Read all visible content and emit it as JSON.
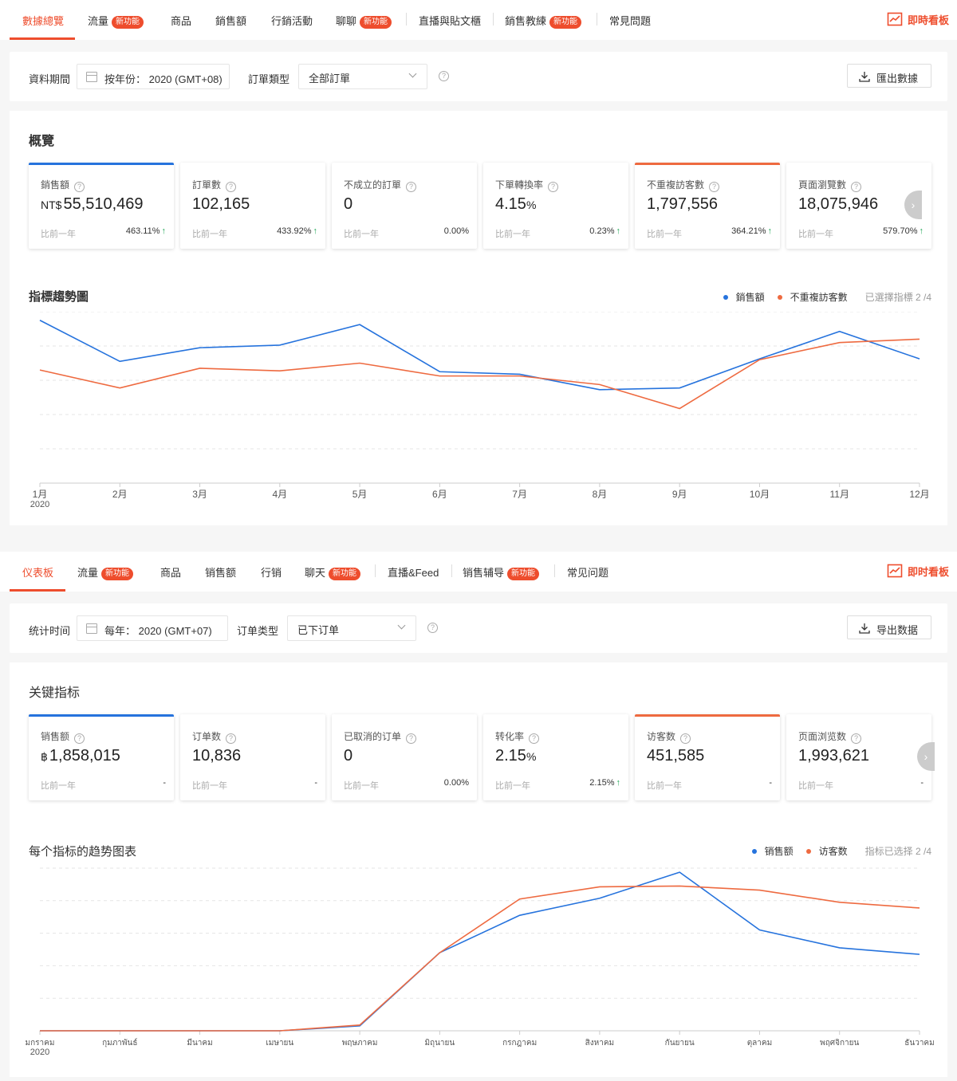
{
  "panel1": {
    "tabs": [
      {
        "label": "數據總覽",
        "badge": "",
        "active": true
      },
      {
        "label": "流量",
        "badge": "新功能"
      },
      {
        "label": "商品",
        "badge": ""
      },
      {
        "label": "銷售額",
        "badge": ""
      },
      {
        "label": "行銷活動",
        "badge": ""
      },
      {
        "label": "聊聊",
        "badge": "新功能"
      },
      {
        "label": "直播與貼文櫃",
        "badge": ""
      },
      {
        "label": "銷售教練",
        "badge": "新功能"
      },
      {
        "label": "常見問題",
        "badge": ""
      }
    ],
    "live_label": "即時看板",
    "filter": {
      "period_label": "資料期間",
      "period_value": "按年份： 2020 (GMT+08)",
      "order_type_label": "訂單類型",
      "order_type_value": "全部訂單",
      "export_label": "匯出數據"
    },
    "overview_title": "概覽",
    "cards": [
      {
        "label": "銷售額",
        "currency": "NT$",
        "value": "55,510,469",
        "pct": "",
        "prev": "比前一年",
        "change": "463.11%",
        "up": true,
        "accent": "blue"
      },
      {
        "label": "訂單數",
        "currency": "",
        "value": "102,165",
        "pct": "",
        "prev": "比前一年",
        "change": "433.92%",
        "up": true,
        "accent": ""
      },
      {
        "label": "不成立的訂單",
        "currency": "",
        "value": "0",
        "pct": "",
        "prev": "比前一年",
        "change": "0.00%",
        "up": false,
        "accent": ""
      },
      {
        "label": "下單轉換率",
        "currency": "",
        "value": "4.15",
        "pct": "%",
        "prev": "比前一年",
        "change": "0.23%",
        "up": true,
        "accent": ""
      },
      {
        "label": "不重複訪客數",
        "currency": "",
        "value": "1,797,556",
        "pct": "",
        "prev": "比前一年",
        "change": "364.21%",
        "up": true,
        "accent": "orange"
      },
      {
        "label": "頁面瀏覽數",
        "currency": "",
        "value": "18,075,946",
        "pct": "",
        "prev": "比前一年",
        "change": "579.70%",
        "up": true,
        "accent": ""
      }
    ],
    "trend_title": "指標趨勢圖",
    "legend": {
      "s1": "銷售額",
      "s2": "不重複訪客數",
      "selected": "已選擇指標 2 /4"
    }
  },
  "panel2": {
    "tabs": [
      {
        "label": "仪表板",
        "badge": "",
        "active": true
      },
      {
        "label": "流量",
        "badge": "新功能"
      },
      {
        "label": "商品",
        "badge": ""
      },
      {
        "label": "销售额",
        "badge": ""
      },
      {
        "label": "行销",
        "badge": ""
      },
      {
        "label": "聊天",
        "badge": "新功能"
      },
      {
        "label": "直播&Feed",
        "badge": ""
      },
      {
        "label": "销售辅导",
        "badge": "新功能"
      },
      {
        "label": "常见问题",
        "badge": ""
      }
    ],
    "live_label": "即时看板",
    "filter": {
      "period_label": "统计时间",
      "period_value": "每年： 2020 (GMT+07)",
      "order_type_label": "订单类型",
      "order_type_value": "已下订单",
      "export_label": "导出数据"
    },
    "overview_title": "关键指标",
    "cards": [
      {
        "label": "销售额",
        "currency": "฿",
        "value": "1,858,015",
        "pct": "",
        "prev": "比前一年",
        "change": "-",
        "up": false,
        "accent": "blue"
      },
      {
        "label": "订单数",
        "currency": "",
        "value": "10,836",
        "pct": "",
        "prev": "比前一年",
        "change": "-",
        "up": false,
        "accent": ""
      },
      {
        "label": "已取消的订单",
        "currency": "",
        "value": "0",
        "pct": "",
        "prev": "比前一年",
        "change": "0.00%",
        "up": false,
        "accent": ""
      },
      {
        "label": "转化率",
        "currency": "",
        "value": "2.15",
        "pct": "%",
        "prev": "比前一年",
        "change": "2.15%",
        "up": true,
        "accent": ""
      },
      {
        "label": "访客数",
        "currency": "",
        "value": "451,585",
        "pct": "",
        "prev": "比前一年",
        "change": "-",
        "up": false,
        "accent": "orange"
      },
      {
        "label": "页面浏览数",
        "currency": "",
        "value": "1,993,621",
        "pct": "",
        "prev": "比前一年",
        "change": "-",
        "up": false,
        "accent": ""
      }
    ],
    "trend_title": "每个指标的趋势图表",
    "legend": {
      "s1": "销售额",
      "s2": "访客数",
      "selected": "指标已选择 2 /4"
    }
  },
  "colors": {
    "accent": "#ee4d2d",
    "blue_series": "#2673dd",
    "orange_series": "#ee6a40",
    "up": "#26aa5a"
  },
  "chart_data": [
    {
      "type": "line",
      "title": "指標趨勢圖",
      "x": [
        "1月",
        "2月",
        "3月",
        "4月",
        "5月",
        "6月",
        "7月",
        "8月",
        "9月",
        "10月",
        "11月",
        "12月"
      ],
      "x_sub": "2020",
      "ylim": [
        0,
        100
      ],
      "grid": true,
      "legend_position": "top-right",
      "series": [
        {
          "name": "銷售額",
          "color": "#2673dd",
          "values": [
            95,
            71,
            79,
            80.5,
            92.5,
            65,
            63.5,
            54.5,
            55.5,
            72.5,
            88.5,
            72.5
          ]
        },
        {
          "name": "不重複訪客數",
          "color": "#ee6a40",
          "values": [
            66,
            55.5,
            67,
            65.5,
            70,
            62.5,
            62.5,
            57.5,
            43.5,
            72,
            82,
            84
          ]
        }
      ]
    },
    {
      "type": "line",
      "title": "每个指标的趋势图表",
      "x": [
        "มกราคม",
        "กุมภาพันธ์",
        "มีนาคม",
        "เมษายน",
        "พฤษภาคม",
        "มิถุนายน",
        "กรกฎาคม",
        "สิงหาคม",
        "กันยายน",
        "ตุลาคม",
        "พฤศจิกายน",
        "ธันวาคม"
      ],
      "x_sub": "2020",
      "ylim": [
        0,
        100
      ],
      "grid": true,
      "legend_position": "top-right",
      "series": [
        {
          "name": "销售额",
          "color": "#2673dd",
          "values": [
            0,
            0,
            0,
            0,
            3,
            48,
            71,
            81.5,
            97.5,
            62,
            51,
            47
          ]
        },
        {
          "name": "访客数",
          "color": "#ee6a40",
          "values": [
            0,
            0,
            0,
            0,
            3.5,
            48,
            81,
            88.5,
            89,
            86.5,
            79,
            75.5
          ]
        }
      ]
    }
  ]
}
